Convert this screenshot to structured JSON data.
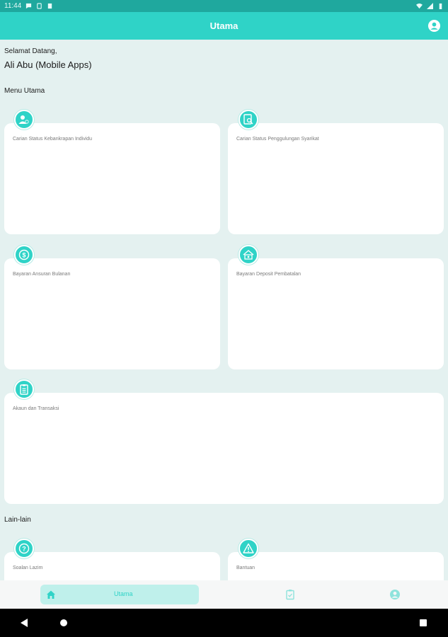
{
  "status_bar": {
    "time": "11:44"
  },
  "app_bar": {
    "title": "Utama"
  },
  "greeting": {
    "welcome": "Selamat Datang,",
    "user": "Ali Abu (Mobile Apps)"
  },
  "sections": {
    "main_menu": "Menu Utama",
    "others": "Lain-lain"
  },
  "menu": {
    "individual_bankruptcy": "Carian Status Kebankrapan Individu",
    "company_winding_up": "Carian Status Penggulungan Syarikat",
    "monthly_installment": "Bayaran Ansuran Bulanan",
    "suspension_deposit": "Bayaran Deposit Pembatalan",
    "account_transactions": "Akaun dan Transaksi"
  },
  "others": {
    "faq": "Soalan Lazim",
    "help": "Bantuan"
  },
  "bottom_nav": {
    "home_label": "Utama"
  },
  "colors": {
    "primary": "#2fd3c7",
    "status_bar": "#1fa89e",
    "background": "#e4f1f0"
  }
}
